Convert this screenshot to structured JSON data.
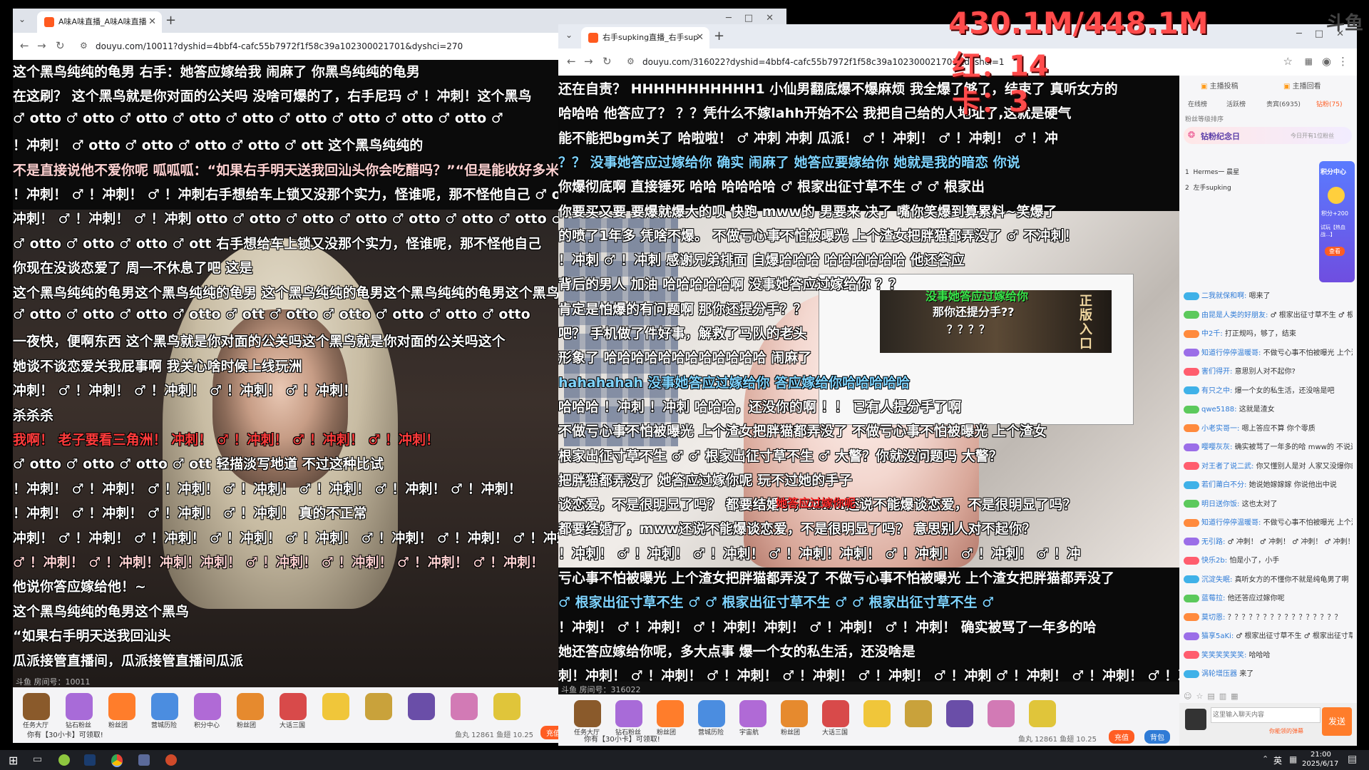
{
  "overlay": {
    "memory": "430.1M/448.1M",
    "red": "红：14",
    "lag": "卡：3",
    "corner_logo": "斗鱼"
  },
  "left_window": {
    "tab_title": "A味A味直播_A味A味直播",
    "url": "douyu.com/10011?dyshid=4bbf4-cafc55b7972f1f58c39a102300021701&dyshci=270",
    "room_label": "斗鱼 房间号：10011",
    "claim_text": "你有【30小卡】可领取!",
    "stats": "鱼丸 12861   鱼翅 10.25",
    "recharge": "充值",
    "danmaku": [
      "这个黑鸟纯纯的龟男              右手：她答应嫁给我 闹麻了              你黑鸟纯纯的龟男",
      "在这刷？        这个黑鸟就是你对面的公关吗        没啥可爆的了，右手尼玛 ♂ ！冲刺！这个黑鸟",
      "♂ otto ♂ otto ♂ otto ♂ otto     ♂ otto ♂ otto ♂ otto ♂ otto ♂ otto ♂",
      "！冲刺！              ♂ otto ♂ otto ♂ otto ♂ otto ♂ ott          这个黑鸟纯纯的",
      "不是直接说他不爱你呢    呱呱呱：“如果右手明天送我回汕头你会吃醋吗？”“但是能收好多米”",
      "！冲刺！ ♂ ！冲刺！ ♂ ！冲刺右手想给车上锁又没那个实力，怪谁呢，那不怪他自己      ♂ otto ♂",
      "冲刺！ ♂ ！冲刺！ ♂ ！冲刺 otto ♂ otto ♂ otto ♂ otto ♂ otto ♂ otto      ♂ otto ♂",
      "♂ otto ♂ otto ♂ otto ♂ ott          右手想给车上锁又没那个实力，怪谁呢，那不怪他自己",
      "                                             你现在没谈恋爱了 周一不休息了吧             这是",
      "这个黑鸟纯纯的龟男这个黑鸟纯纯的龟男       这个黑鸟纯纯的龟男这个黑鸟纯纯的龟男这个黑鸟",
      "♂ otto ♂ otto ♂ otto ♂ otto ♂ ott               ♂ otto ♂ otto ♂ otto ♂ otto ♂ otto",
      "一夜快，便啊东西              这个黑鸟就是你对面的公关吗这个黑鸟就是你对面的公关吗这个",
      "                                              她谈不谈恋爱关我屁事啊 我关心啥时候上线玩洲",
      "                                    冲刺！ ♂ ！冲刺！ ♂ ！冲刺！ ♂ ！冲刺！ ♂ ！冲刺！",
      "                                                         杀杀杀",
      "我啊！ 老子要看三角洲！                      冲刺！ ♂ ！冲刺！ ♂ ！冲刺！ ♂ ！冲刺！",
      "♂ otto ♂ otto ♂ otto ♂ ott                              轻描淡写地道 不过这种比试",
      "！冲刺！ ♂ ！冲刺！ ♂ ！冲刺！ ♂ ！冲刺！ ♂ ！冲刺！ ♂ ！冲刺！ ♂ ！冲刺！",
      "！冲刺！ ♂ ！冲刺！ ♂ ！冲刺！ ♂ ！冲刺！                              真的不正常",
      "冲刺！ ♂ ！冲刺！ ♂ ！冲刺！ ♂ ！冲刺！ ♂ ！冲刺！ ♂ ！冲刺！ ♂ ！冲刺！ ♂ ！冲刺！",
      "♂ ！冲刺！ ♂ ！冲刺！冲刺！冲刺！ ♂ ！冲刺！ ♂ ！冲刺！ ♂ ！冲刺！ ♂ ！冲刺！",
      "                                                                他说你答应嫁给他！~",
      "                                                        这个黑鸟纯纯的龟男这个黑鸟",
      "                                                          “如果右手明天送我回汕头",
      "                                                     瓜派接管直播间，瓜派接管直播间瓜派"
    ],
    "gifts": [
      "任务大厅",
      "钻石粉丝",
      "粉丝团",
      "营城历险",
      "积分中心",
      "粉丝团",
      "大话三国",
      "",
      "",
      "",
      "",
      ""
    ]
  },
  "right_window": {
    "tab_title": "右手supking直播_右手sup",
    "url": "douyu.com/316022?dyshid=4bbf4-cafc55b7972f1f58c39a102300021701&dyshci=1",
    "room_label": "斗鱼 房间号：316022",
    "claim_text": "你有【30小卡】可领取!",
    "stats": "鱼丸 12861   鱼翅 10.25",
    "recharge": "充值",
    "recharge2": "背包",
    "danmaku": [
      "还在自责？        HHHHHHHHHHH1        小仙男翻底爆不爆麻烦 我全爆了够了，结束了  真听女方的",
      "哈哈哈      他答应了？        ？？凭什么不嫁lahh开始不公 我把自己给的人地址了,这就是硬气",
      "      能不能把bgm关了        哈啦啦！ ♂ 冲刺 冲刺 瓜派！ ♂ ！冲刺！ ♂ ！冲刺！ ♂ ！冲",
      "？？      没事她答应过嫁给你          确实          闹麻了 她答应要嫁给你 她就是我的暗恋 你说",
      "你爆彻底啊 直接锤死                    哈哈          哈哈哈哈       ♂ 根家出征寸草不生 ♂ ♂ 根家出",
      "            你要买又要 要爆就爆大的呗          快跑 mww的 男要来 决了       嘴你笑爆到算累料~笑爆了",
      "的喷了1年多 凭啥不爆。          不做亏心事不怕被曝光 上个渣女把胖猫都弄没了           ♂ 不冲刺！",
      "！冲刺      ♂ ！冲刺           感谢兄弟排面            自爆哈哈哈         哈哈哈哈哈哈      他还答应",
      "  背后的男人 加油           哈哈哈哈哈啊              没事她答应过嫁给你             ？？",
      "        肯定是怕爆的有问题啊                 那你还提分手？？",
      "吧？      手机做了件好事，解救了马队的老头",
      "形象了            哈哈哈哈哈哈哈哈哈哈哈哈                  闹麻了",
      "  hahahahah               没事她答应过嫁给你          答应嫁给你哈哈哈哈哈",
      "哈哈哈    ！冲刺 ！冲刺     哈哈哈，还没你的啊          ！！        已有人提分手了啊",
      "            不做亏心事不怕被曝光 上个渣女把胖猫都弄没了        不做亏心事不怕被曝光 上个渣女",
      "根家出征寸草不生 ♂ ♂ 根家出征寸草不生 ♂                          大警？你就没问题吗 大警？",
      "把胖猫都弄没了                       她答应过嫁你呢                       玩不过她的手子",
      "谈恋爱，不是很明显了吗？      都要结婚了，mww还说不能爆谈恋爱，不是很明显了吗？",
      "    都要结婚了，mww还说不能爆谈恋爱，不是很明显了吗？                 意思别人对不起你？",
      "！冲刺！ ♂ ！冲刺！ ♂ ！冲刺！ ♂ ！冲刺！冲刺！ ♂ ！冲刺！ ♂ ！冲刺！ ♂ ！冲",
      "亏心事不怕被曝光 上个渣女把胖猫都弄没了        不做亏心事不怕被曝光 上个渣女把胖猫都弄没了",
      "            ♂ 根家出征寸草不生 ♂ ♂ 根家出征寸草不生 ♂ ♂ 根家出征寸草不生 ♂",
      "！冲刺！ ♂ ！冲刺！ ♂ ！冲刺！冲刺！ ♂ ！冲刺！ ♂ ！冲刺！             确实被骂了一年多的哈",
      "                                  她还答应嫁给你呢，多大点事          爆一个女的私生活，还没啥是",
      "刺！冲刺！ ♂ ！冲刺！ ♂ ！冲刺！ ♂ ！冲刺！ ♂ ！冲刺！ ♂ ！冲刺 ♂ ！冲刺！ ♂ ！冲刺！ ♂ ！冲"
    ],
    "inner_overlay": {
      "top": "没事她答应过嫁给你",
      "question": "那你还提分手??",
      "marks": "？？？？",
      "red": "她答应过嫁你呢",
      "stamp": "正版入口"
    },
    "gifts": [
      "任务大厅",
      "钻石粉丝",
      "粉丝团",
      "营城历险",
      "宇宙航",
      "粉丝团",
      "大话三国",
      "",
      "",
      "",
      "",
      ""
    ]
  },
  "sidebar": {
    "top_links": [
      "主播投稿",
      "主播回看"
    ],
    "tabs": [
      "在线榜",
      "活跃榜",
      "贵宾(6935)",
      "钻粉(75)"
    ],
    "rank_label": "粉丝等级排序",
    "event_title": "钻粉纪念日",
    "event_sub": "今日开有1位粉丝",
    "ranks": [
      {
        "num": "1",
        "name": "Hermes一 晨星"
      },
      {
        "num": "2",
        "name": "左手supking"
      }
    ],
    "promo": [
      "积分中心",
      "积分+200",
      "试玩【热血战...】",
      "查看"
    ],
    "chat": [
      {
        "user": "二我就保和啊:",
        "msg": "嗯来了"
      },
      {
        "user": "由昆是人类的好朋友:",
        "msg": "♂ 根家出征寸草不生 ♂ 根家出征寸草不生"
      },
      {
        "user": "中2千:",
        "msg": "打正规吗，够了，结束"
      },
      {
        "user": "知道行停停温暖哥:",
        "msg": "不做亏心事不怕被曝光 上个渣女把胖猫都弄没了"
      },
      {
        "user": "害们得开:",
        "msg": "意思别人对不起你?"
      },
      {
        "user": "有只之中:",
        "msg": "爆一个女的私生活，还没啥是吧"
      },
      {
        "user": "qwe5188:",
        "msg": "这就是渣女"
      },
      {
        "user": "小老实哥一:",
        "msg": "嗯上答应不算 你个零质"
      },
      {
        "user": "嘤嘤灰灰:",
        "msg": "确实被骂了一年多的哈 mww的 不说还得捧着看多久不知道"
      },
      {
        "user": "对王者了说二武:",
        "msg": "你又懂别人是对 人家又没爆你的，你还要起来了，你有必小人啊"
      },
      {
        "user": "若们莆白不分:",
        "msg": "她说她嫁嫁嫁 你说他出中说"
      },
      {
        "user": "明日送你饭:",
        "msg": "这也太对了"
      },
      {
        "user": "知道行停停温暖哥:",
        "msg": "不做亏心事不怕被曝光 上个渣女把胖猫都弄没了"
      },
      {
        "user": "无引路:",
        "msg": "♂ 冲刺！ ♂ 冲刺！ ♂ 冲刺！ ♂ 冲刺！ ♂ 冲刺！"
      },
      {
        "user": "快乐2b:",
        "msg": "怕是小了，小手"
      },
      {
        "user": "沉淀失眠:",
        "msg": "真听女方的不懂你不就是纯龟男了啊"
      },
      {
        "user": "蓝莓拉:",
        "msg": "他还答应过嫁你呢"
      },
      {
        "user": "莫切恩:",
        "msg": "？？？？？？？？？？？？？？？？"
      },
      {
        "user": "猫享5aKi:",
        "msg": "♂ 根家出征寸草不生 ♂ 根家出征寸草不生"
      },
      {
        "user": "笑笑笑笑笑笑:",
        "msg": "哈哈哈"
      },
      {
        "user": "涡轮增压器",
        "msg": "来了"
      }
    ],
    "input_placeholder": "这里输入聊天内容",
    "send_label": "发送",
    "tip": "你能领的弹幕"
  },
  "taskbar": {
    "ime": "英",
    "time": "21:00",
    "date": "2025/6/17"
  }
}
